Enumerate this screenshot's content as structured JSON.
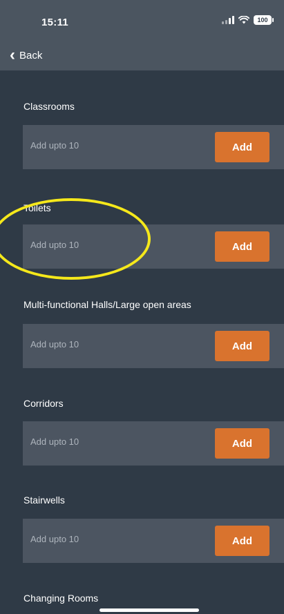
{
  "status_bar": {
    "time": "15:11",
    "battery": "100",
    "signal_icon": "signal-bars-icon",
    "wifi_icon": "wifi-icon"
  },
  "nav": {
    "back_label": "Back",
    "back_icon": "chevron-left-icon"
  },
  "sections": [
    {
      "title": "Classrooms",
      "hint": "Add upto 10",
      "button": "Add"
    },
    {
      "title": "Toilets",
      "hint": "Add upto 10",
      "button": "Add"
    },
    {
      "title": "Multi-functional Halls/Large open areas",
      "hint": "Add upto 10",
      "button": "Add"
    },
    {
      "title": "Corridors",
      "hint": "Add upto 10",
      "button": "Add"
    },
    {
      "title": "Stairwells",
      "hint": "Add upto 10",
      "button": "Add"
    },
    {
      "title": "Changing Rooms"
    }
  ],
  "colors": {
    "background": "#2f3a46",
    "bar": "#4b5560",
    "row": "#4c5561",
    "accent": "#d9732e",
    "annotation": "#f5e81b"
  }
}
